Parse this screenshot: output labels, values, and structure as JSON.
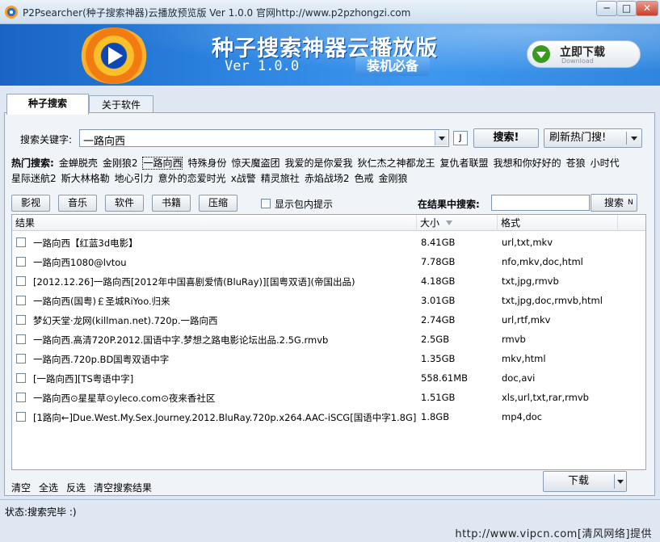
{
  "window": {
    "title": "P2Psearcher(种子搜索神器)云播放预览版 Ver 1.0.0 官网http://www.p2pzhongzi.com",
    "min": "─",
    "max": "□",
    "close": "✕"
  },
  "banner": {
    "title": "种子搜索神器云播放版",
    "version": "Ver 1.0.0",
    "tag": "装机必备",
    "download_now": "立即下载",
    "download_sub": "Download"
  },
  "tabs": [
    "种子搜索",
    "关于软件"
  ],
  "search": {
    "label": "搜索关键字:",
    "value": "一路向西",
    "j_button": "J",
    "search_button": "搜索!",
    "refresh_button": "刷新热门搜!"
  },
  "hot": {
    "label": "热门搜索:",
    "keywords": [
      "金蝉脱壳",
      "金刚狼2",
      "一路向西",
      "特殊身份",
      "惊天魔盗团",
      "我爱的是你爱我",
      "狄仁杰之神都龙王",
      "复仇者联盟",
      "我想和你好好的",
      "苍狼",
      "小时代",
      "星际迷航2",
      "斯大林格勒",
      "地心引力",
      "意外的恋爱时光",
      "x战警",
      "精灵旅社",
      "赤焰战场2",
      "色戒",
      "金刚狼"
    ]
  },
  "categories": [
    "影视",
    "音乐",
    "软件",
    "书籍",
    "压缩"
  ],
  "show_inner": "显示包内提示",
  "filter": {
    "label": "在结果中搜索:",
    "button": "搜索",
    "suffix": "N"
  },
  "table": {
    "headers": [
      "结果",
      "大小",
      "格式"
    ],
    "rows": [
      {
        "name": "一路向西【红蓝3d电影】",
        "size": "8.41GB",
        "format": "url,txt,mkv"
      },
      {
        "name": "一路向西1080@lvtou",
        "size": "7.78GB",
        "format": "nfo,mkv,doc,html"
      },
      {
        "name": "[2012.12.26]一路向西[2012年中国喜剧爱情(BluRay)][国粤双语](帝国出品)",
        "size": "4.18GB",
        "format": "txt,jpg,rmvb"
      },
      {
        "name": "一路向西(国粤)￡圣城RiYoo.归来",
        "size": "3.01GB",
        "format": "txt,jpg,doc,rmvb,html"
      },
      {
        "name": "梦幻天堂·龙网(killman.net).720p.一路向西",
        "size": "2.74GB",
        "format": "url,rtf,mkv"
      },
      {
        "name": "一路向西.高清720P.2012.国语中字.梦想之路电影论坛出品.2.5G.rmvb",
        "size": "2.5GB",
        "format": "rmvb"
      },
      {
        "name": "一路向西.720p.BD国粤双语中字",
        "size": "1.35GB",
        "format": "mkv,html"
      },
      {
        "name": "[一路向西][TS粤语中字]",
        "size": "558.61MB",
        "format": "doc,avi"
      },
      {
        "name": "一路向西⊙星星草⊙yleco.com⊙夜来香社区",
        "size": "1.51GB",
        "format": "xls,url,txt,rar,rmvb"
      },
      {
        "name": "[1路向←]Due.West.My.Sex.Journey.2012.BluRay.720p.x264.AAC-iSCG[国语中字1.8G]",
        "size": "1.8GB",
        "format": "mp4,doc"
      }
    ]
  },
  "bottom_links": [
    "清空",
    "全选",
    "反选",
    "清空搜索结果"
  ],
  "download_button": "下载",
  "status": "状态:搜索完毕 :)",
  "footer": "http://www.vipcn.com[清风网络]提供"
}
